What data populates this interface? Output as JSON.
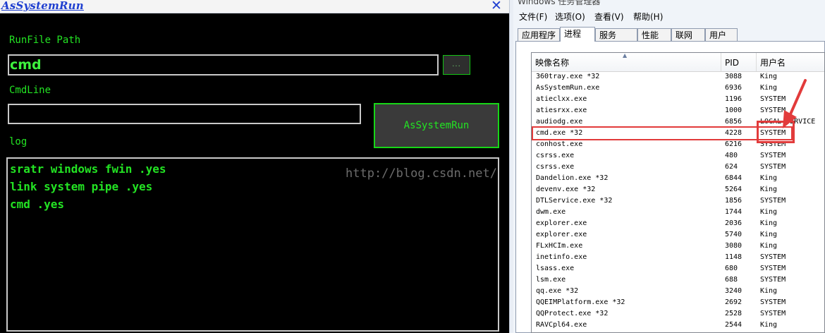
{
  "app": {
    "title": "AsSystemRun",
    "close_glyph": "✕",
    "runfile_label": "RunFile Path",
    "runfile_value": "cmd",
    "browse_label": "...",
    "cmdline_label": "CmdLine",
    "cmdline_value": "",
    "run_button": "AsSystemRun",
    "log_label": "log",
    "log_lines": [
      "sratr windows fwin .yes",
      "link system pipe .yes",
      "cmd .yes"
    ],
    "watermark": "http://blog.csdn.net/"
  },
  "taskmgr": {
    "title": "Windows 任务管理器",
    "menu": [
      "文件(F)",
      "选项(O)",
      "查看(V)",
      "帮助(H)"
    ],
    "tabs": [
      "应用程序",
      "进程",
      "服务",
      "性能",
      "联网",
      "用户"
    ],
    "active_tab": "进程",
    "columns": [
      "映像名称",
      "PID",
      "用户名"
    ],
    "highlighted_process": "cmd.exe *32",
    "processes": [
      {
        "name": "360tray.exe *32",
        "pid": "3088",
        "user": "King"
      },
      {
        "name": "AsSystemRun.exe",
        "pid": "6936",
        "user": "King"
      },
      {
        "name": "atieclxx.exe",
        "pid": "1196",
        "user": "SYSTEM"
      },
      {
        "name": "atiesrxx.exe",
        "pid": "1000",
        "user": "SYSTEM"
      },
      {
        "name": "audiodg.exe",
        "pid": "6856",
        "user": "LOCAL SERVICE"
      },
      {
        "name": "cmd.exe *32",
        "pid": "4228",
        "user": "SYSTEM"
      },
      {
        "name": "conhost.exe",
        "pid": "6216",
        "user": "SYSTEM"
      },
      {
        "name": "csrss.exe",
        "pid": "480",
        "user": "SYSTEM"
      },
      {
        "name": "csrss.exe",
        "pid": "624",
        "user": "SYSTEM"
      },
      {
        "name": "Dandelion.exe *32",
        "pid": "6844",
        "user": "King"
      },
      {
        "name": "devenv.exe *32",
        "pid": "5264",
        "user": "King"
      },
      {
        "name": "DTLService.exe *32",
        "pid": "1856",
        "user": "SYSTEM"
      },
      {
        "name": "dwm.exe",
        "pid": "1744",
        "user": "King"
      },
      {
        "name": "explorer.exe",
        "pid": "2036",
        "user": "King"
      },
      {
        "name": "explorer.exe",
        "pid": "5740",
        "user": "King"
      },
      {
        "name": "FLxHCIm.exe",
        "pid": "3080",
        "user": "King"
      },
      {
        "name": "inetinfo.exe",
        "pid": "1148",
        "user": "SYSTEM"
      },
      {
        "name": "lsass.exe",
        "pid": "680",
        "user": "SYSTEM"
      },
      {
        "name": "lsm.exe",
        "pid": "688",
        "user": "SYSTEM"
      },
      {
        "name": "qq.exe *32",
        "pid": "3240",
        "user": "King"
      },
      {
        "name": "QQEIMPlatform.exe *32",
        "pid": "2692",
        "user": "SYSTEM"
      },
      {
        "name": "QQProtect.exe *32",
        "pid": "2528",
        "user": "SYSTEM"
      },
      {
        "name": "RAVCpl64.exe",
        "pid": "2544",
        "user": "King"
      }
    ]
  },
  "colors": {
    "app_bg": "#000000",
    "app_text": "#23e323",
    "title_blue": "#1f3fd0",
    "highlight_red": "#e23b3b"
  }
}
